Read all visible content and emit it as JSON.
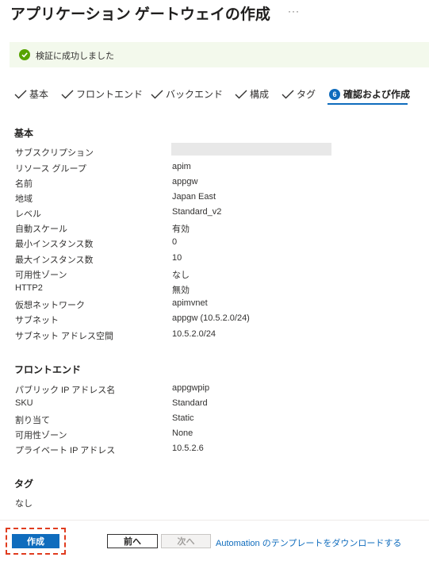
{
  "page": {
    "title": "アプリケーション ゲートウェイの作成",
    "more_label": "···"
  },
  "banner": {
    "icon": "check-circle-icon",
    "message": "検証に成功しました",
    "color": "#57a300"
  },
  "steps": [
    {
      "label": "基本",
      "status": "done"
    },
    {
      "label": "フロントエンド",
      "status": "done"
    },
    {
      "label": "バックエンド",
      "status": "done"
    },
    {
      "label": "構成",
      "status": "done"
    },
    {
      "label": "タグ",
      "status": "done"
    },
    {
      "number": "6",
      "label": "確認および作成",
      "status": "active"
    }
  ],
  "basics": {
    "title": "基本",
    "rows": [
      {
        "key": "サブスクリプション",
        "value": ""
      },
      {
        "key": "リソース グループ",
        "value": "apim"
      },
      {
        "key": "名前",
        "value": "appgw"
      },
      {
        "key": "地域",
        "value": "Japan East"
      },
      {
        "key": "レベル",
        "value": "Standard_v2"
      },
      {
        "key": "自動スケール",
        "value": "有効"
      },
      {
        "key": "最小インスタンス数",
        "value": "0"
      },
      {
        "key": "最大インスタンス数",
        "value": "10"
      },
      {
        "key": "可用性ゾーン",
        "value": "なし"
      },
      {
        "key": "HTTP2",
        "value": "無効"
      },
      {
        "key": "仮想ネットワーク",
        "value": "apimvnet"
      },
      {
        "key": "サブネット",
        "value": "appgw (10.5.2.0/24)"
      },
      {
        "key": "サブネット アドレス空間",
        "value": "10.5.2.0/24"
      }
    ]
  },
  "frontend": {
    "title": "フロントエンド",
    "rows": [
      {
        "key": "パブリック IP アドレス名",
        "value": "appgwpip"
      },
      {
        "key": "SKU",
        "value": "Standard"
      },
      {
        "key": "割り当て",
        "value": "Static"
      },
      {
        "key": "可用性ゾーン",
        "value": "None"
      },
      {
        "key": "プライベート IP アドレス",
        "value": "10.5.2.6"
      }
    ]
  },
  "tags": {
    "title": "タグ",
    "value": "なし"
  },
  "footer": {
    "create_label": "作成",
    "prev_label": "前へ",
    "next_label": "次へ",
    "automation_link": "Automation のテンプレートをダウンロードする"
  },
  "colors": {
    "accent": "#0f6cbd",
    "highlight_border": "#e03c1f",
    "success_bg": "#f3f9ec"
  }
}
